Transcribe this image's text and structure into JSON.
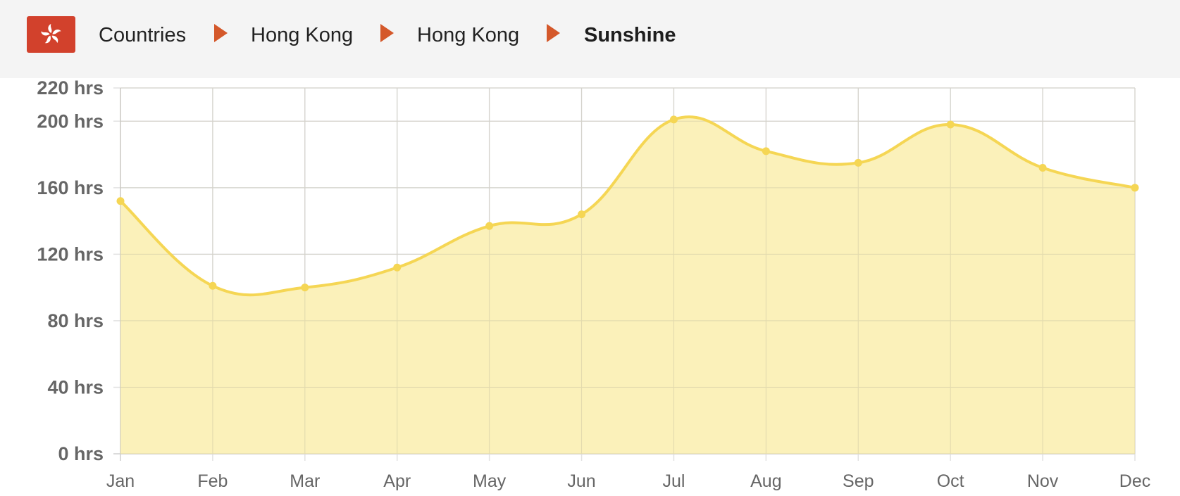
{
  "breadcrumb": {
    "flag_icon": "hong-kong-flag-icon",
    "flag_color": "#d2412c",
    "items": [
      {
        "label": "Countries"
      },
      {
        "label": "Hong Kong"
      },
      {
        "label": "Hong Kong"
      },
      {
        "label": "Sunshine"
      }
    ],
    "separator_color": "#d4582a"
  },
  "chart_data": {
    "type": "area",
    "categories": [
      "Jan",
      "Feb",
      "Mar",
      "Apr",
      "May",
      "Jun",
      "Jul",
      "Aug",
      "Sep",
      "Oct",
      "Nov",
      "Dec"
    ],
    "series": [
      {
        "values": [
          152,
          101,
          100,
          112,
          137,
          144,
          201,
          182,
          175,
          198,
          172,
          160
        ],
        "color": "#f5d654",
        "fill": "#faeeae"
      }
    ],
    "yticks": [
      0,
      40,
      80,
      120,
      160,
      200,
      220
    ],
    "ytick_labels": [
      "0 hrs",
      "40 hrs",
      "80 hrs",
      "120 hrs",
      "160 hrs",
      "200 hrs",
      "220 hrs"
    ],
    "ylim": [
      0,
      220
    ],
    "grid": true
  }
}
